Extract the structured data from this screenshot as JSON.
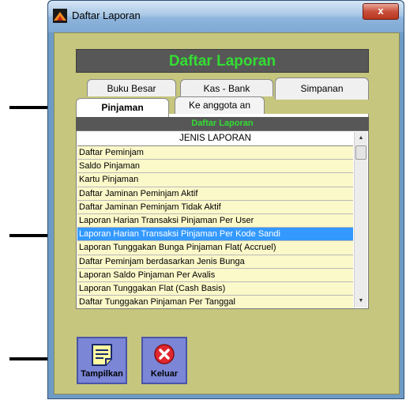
{
  "window": {
    "title": "Daftar Laporan",
    "close_label": "x"
  },
  "header": {
    "title": "Daftar Laporan"
  },
  "tabs": {
    "back_row": [
      {
        "label": "Buku Besar"
      },
      {
        "label": "Kas - Bank"
      },
      {
        "label": "Simpanan"
      }
    ],
    "front_row": [
      {
        "label": "Pinjaman",
        "active": true
      },
      {
        "label": "Ke anggota an"
      }
    ]
  },
  "list": {
    "subheader": "Daftar Laporan",
    "column_header": "JENIS LAPORAN",
    "items": [
      "Daftar Peminjam",
      "Saldo Pinjaman",
      "Kartu Pinjaman",
      "Daftar Jaminan Peminjam Aktif",
      "Daftar Jaminan Peminjam Tidak Aktif",
      "Laporan Harian Transaksi Pinjaman Per User",
      "Laporan Harian Transaksi Pinjaman Per Kode Sandi",
      "Laporan Tunggakan Bunga Pinjaman Flat( Accruel)",
      "Daftar Peminjam berdasarkan Jenis Bunga",
      "Laporan Saldo Pinjaman Per Avalis",
      "Laporan Tunggakan Flat (Cash Basis)",
      "Daftar Tunggakan Pinjaman Per Tanggal"
    ],
    "selected_index": 6
  },
  "buttons": {
    "show_label": "Tampilkan",
    "exit_label": "Keluar"
  },
  "colors": {
    "client_bg": "#c6c67e",
    "banner_bg": "#575757",
    "banner_text": "#33dd33",
    "list_item_bg": "#fbf8c9",
    "selected_bg": "#3399ff",
    "button_bg": "#7b86d6"
  },
  "icons": {
    "app": "app-icon",
    "show": "note-icon",
    "exit": "close-circle-icon"
  }
}
